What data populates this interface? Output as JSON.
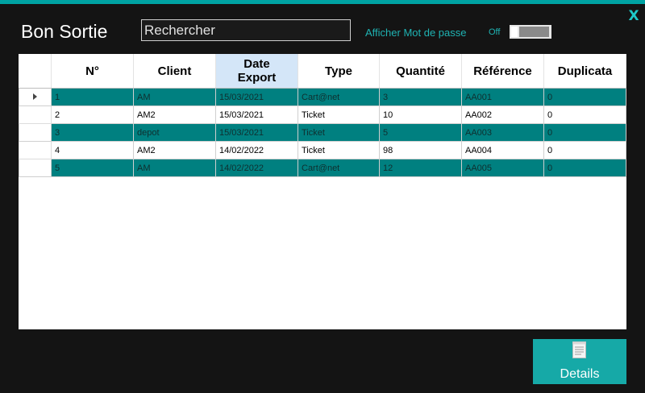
{
  "window": {
    "title": "Bon Sortie",
    "close_label": "X",
    "accent": "#00a3a3"
  },
  "search": {
    "placeholder": "Rechercher",
    "value": ""
  },
  "options": {
    "show_password_label": "Afficher Mot de passe",
    "toggle_label": "Off",
    "toggle_state": false
  },
  "table": {
    "columns": [
      "N°",
      "Client",
      "Date Export",
      "Type",
      "Quantité",
      "Référence",
      "Duplicata"
    ],
    "date_header_line1": "Date",
    "date_header_line2": "Export",
    "rows": [
      [
        "1",
        "AM",
        "15/03/2021",
        "Cart@net",
        "3",
        "AA001",
        "0"
      ],
      [
        "2",
        "AM2",
        "15/03/2021",
        "Ticket",
        "10",
        "AA002",
        "0"
      ],
      [
        "3",
        "depot",
        "15/03/2021",
        "Ticket",
        "5",
        "AA003",
        "0"
      ],
      [
        "4",
        "AM2",
        "14/02/2022",
        "Ticket",
        "98",
        "AA004",
        "0"
      ],
      [
        "5",
        "AM",
        "14/02/2022",
        "Cart@net",
        "12",
        "AA005",
        "0"
      ]
    ],
    "highlight_color": "#008080",
    "current_row_marker": "row-arrow-icon"
  },
  "actions": {
    "details_label": "Details",
    "details_icon": "document-icon"
  }
}
